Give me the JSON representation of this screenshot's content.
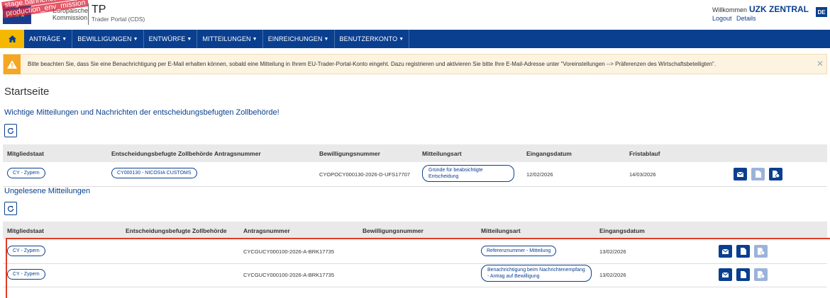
{
  "header": {
    "logo_text": [
      "Europäische",
      "Kommission"
    ],
    "stage_banner": [
      "stage.banner.banner_pre-",
      "production_env_mission"
    ],
    "app_title": "TP",
    "app_subtitle": "Trader Portal (CDS)",
    "welcome_prefix": "Willkommen",
    "user_name": "UZK ZENTRAL",
    "logout_label": "Logout",
    "details_label": "Details",
    "language": "DE"
  },
  "nav": {
    "items": [
      {
        "label": "ANTRÄGE"
      },
      {
        "label": "BEWILLIGUNGEN"
      },
      {
        "label": "ENTWÜRFE"
      },
      {
        "label": "MITTEILUNGEN"
      },
      {
        "label": "EINREICHUNGEN"
      },
      {
        "label": "BENUTZERKONTO"
      }
    ]
  },
  "alert": {
    "text": "Bitte beachten Sie, dass Sie eine Benachrichtigung per E-Mail erhalten können, sobald eine Mitteilung in Ihrem EU-Trader-Portal-Konto eingeht. Dazu registrieren und aktivieren Sie bitte Ihre E-Mail-Adresse unter \"Voreinstellungen --> Präferenzen des Wirtschaftsbeteiligten\"."
  },
  "page_title": "Startseite",
  "section1": {
    "title": "Wichtige Mitteilungen und Nachrichten der entscheidungsbefugten Zollbehörde!",
    "columns": [
      "Mitgliedstaat",
      "Entscheidungsbefugte Zollbehörde",
      "Antragsnummer",
      "Bewilligungsnummer",
      "Mitteilungsart",
      "Eingangsdatum",
      "Fristablauf"
    ],
    "rows": [
      {
        "member_state": "CY - Zypern",
        "authority": "CY000130 - NICOSIA CUSTOMS",
        "application_no": "",
        "authorisation_no": "CYOPOCY000130-2026-D-UFS17707",
        "type": "Gründe für beabsichtigte Entscheidung",
        "received": "12/02/2026",
        "deadline": "14/03/2026"
      }
    ]
  },
  "section2": {
    "title": "Ungelesene Mitteilungen",
    "columns": [
      "Mitgliedstaat",
      "Entscheidungsbefugte Zollbehörde",
      "Antragsnummer",
      "Bewilligungsnummer",
      "Mitteilungsart",
      "Eingangsdatum"
    ],
    "rows": [
      {
        "member_state": "CY - Zypern",
        "authority": "",
        "application_no": "CYCGUCY000100-2026-A-BRK17735",
        "authorisation_no": "",
        "type": "Referenznummer - Mitteilung",
        "received": "13/02/2026"
      },
      {
        "member_state": "CY - Zypern",
        "authority": "",
        "application_no": "CYCGUCY000100-2026-A-BRK17735",
        "authorisation_no": "",
        "type": "Benachrichtigung beim Nachrichtenempfang - Antrag auf Bewilligung",
        "received": "13/02/2026"
      }
    ]
  },
  "colors": {
    "primary": "#0a3f8f",
    "home_yellow": "#f5b800",
    "alert_bg": "#fdf3e1",
    "alert_icon": "#f5a623",
    "highlight_red": "#e03b24",
    "disabled_button": "#9bb3d9"
  },
  "icons": [
    "home-icon",
    "warning-icon",
    "close-icon",
    "refresh-icon",
    "envelope-icon",
    "document-icon",
    "document-clock-icon"
  ]
}
